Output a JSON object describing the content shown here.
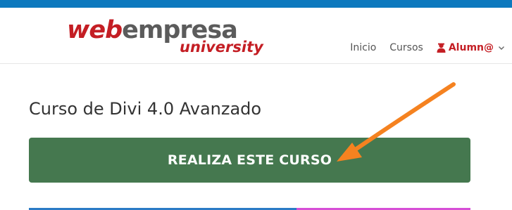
{
  "brand": {
    "logo_web": "web",
    "logo_empresa": "empresa",
    "logo_sub": "university",
    "primary_color": "#c41e24",
    "accent_bar_color": "#0d79be"
  },
  "nav": {
    "items": [
      {
        "label": "Inicio"
      },
      {
        "label": "Cursos"
      }
    ],
    "user": {
      "label": "Alumn@",
      "icon": "user-icon"
    }
  },
  "course": {
    "title": "Curso de Divi 4.0 Avanzado",
    "cta_label": "REALIZA ESTE CURSO",
    "cta_color": "#45784f"
  },
  "annotation": {
    "arrow_color": "#f58220"
  }
}
